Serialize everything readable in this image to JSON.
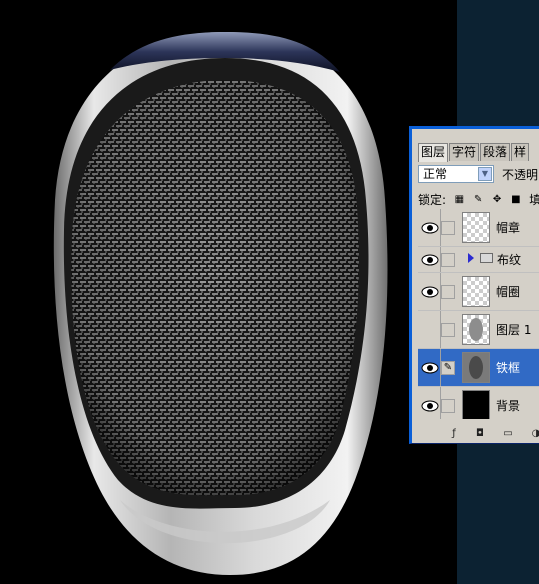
{
  "panel": {
    "tabs": [
      "图层",
      "字符",
      "段落",
      "样"
    ],
    "blend_mode": "正常",
    "opacity_label": "不透明",
    "lock_label": "锁定:",
    "fill_label": "填"
  },
  "layers": [
    {
      "name": "帽章",
      "visible": true,
      "thumb": "transparent"
    },
    {
      "name": "布纹",
      "type": "group",
      "visible": true
    },
    {
      "name": "帽圈",
      "visible": true,
      "thumb": "transparent"
    },
    {
      "name": "图层 1",
      "visible": false,
      "thumb": "oval"
    },
    {
      "name": "铁框",
      "visible": true,
      "selected": true,
      "thumb": "oval"
    },
    {
      "name": "背景",
      "visible": true,
      "thumb": "black"
    }
  ],
  "icons": [
    "eye-icon",
    "brush-icon",
    "folder-icon",
    "lock-icon",
    "move-icon",
    "checker-icon",
    "new-layer-icon",
    "fx-icon",
    "mask-icon",
    "adjust-icon"
  ]
}
